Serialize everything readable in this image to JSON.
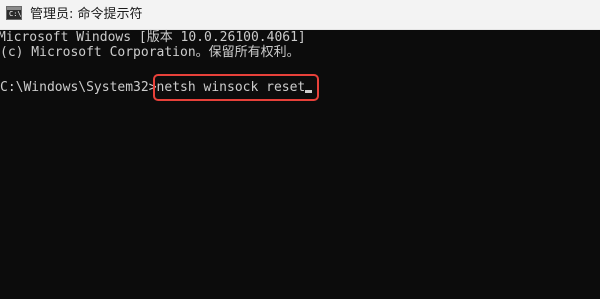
{
  "window": {
    "title": "管理员: 命令提示符",
    "app_icon": "command-prompt-icon",
    "app_icon_glyph": "C:\\"
  },
  "console": {
    "lines": [
      "Microsoft Windows [版本 10.0.26100.4061]",
      "(c) Microsoft Corporation。保留所有权利。"
    ],
    "prompt": "C:\\Windows\\System32>",
    "command": "netsh winsock reset"
  },
  "annotation": {
    "highlight_color": "#e8413a"
  }
}
